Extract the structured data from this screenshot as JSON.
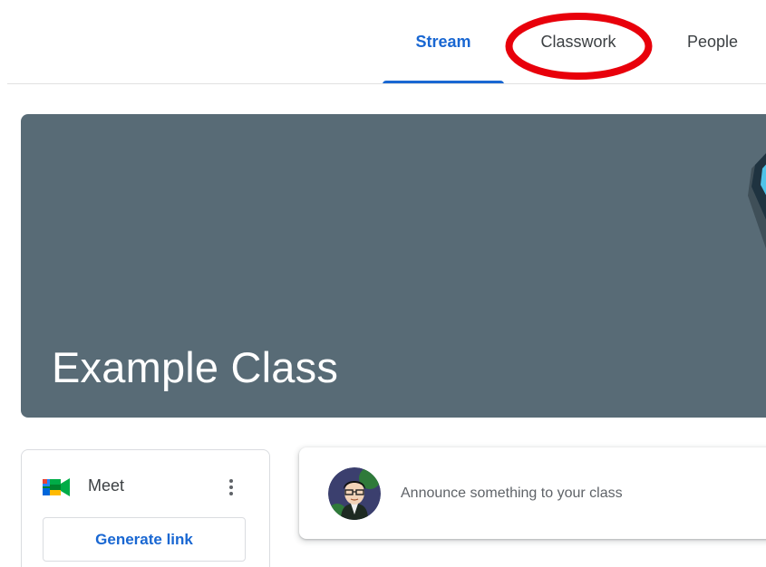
{
  "tabs": {
    "stream": "Stream",
    "classwork": "Classwork",
    "people": "People"
  },
  "banner": {
    "title": "Example Class",
    "background_color": "#586b76"
  },
  "meet": {
    "label": "Meet",
    "generate_link": "Generate link",
    "icon": "google-meet-icon",
    "menu_icon": "more-vert-icon"
  },
  "announce": {
    "placeholder": "Announce something to your class",
    "avatar": "user-avatar"
  },
  "colors": {
    "accent": "#1967d2",
    "highlight": "#e8000b"
  }
}
